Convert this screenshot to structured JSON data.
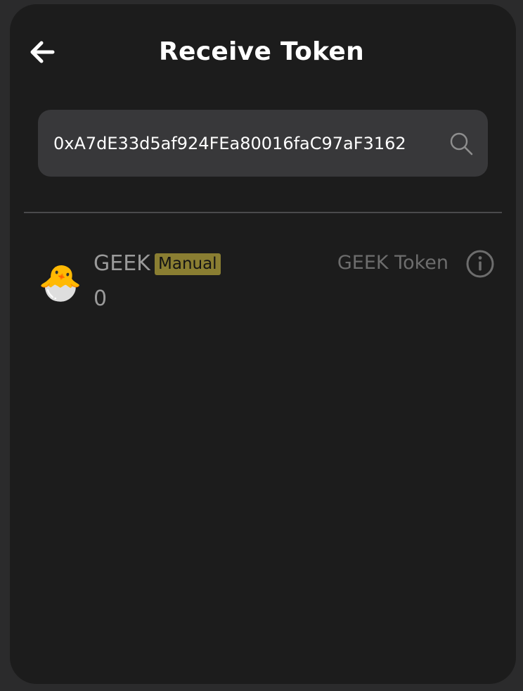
{
  "header": {
    "title": "Receive Token",
    "back_icon": "arrow-left-icon"
  },
  "search": {
    "value": "0xA7dE33d5af924FEa80016faC97aF3162",
    "icon": "search-icon"
  },
  "tokens": [
    {
      "symbol": "GEEK",
      "badge": "Manual",
      "balance": "0",
      "name": "GEEK Token",
      "avatar": "🐣",
      "info_icon": "info-icon"
    }
  ],
  "colors": {
    "background": "#1c1c1c",
    "search_bg": "#38383a",
    "badge_bg": "#8a7e32",
    "divider": "#4a4a4c"
  }
}
